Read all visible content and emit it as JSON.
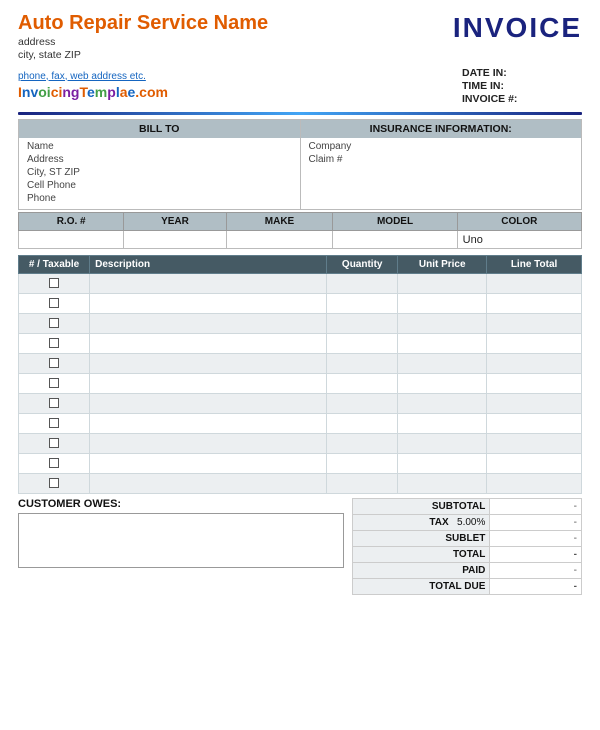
{
  "header": {
    "company_name": "Auto Repair Service Name",
    "invoice_title": "INVOICE",
    "address1": "address",
    "address2": "city, state ZIP",
    "phone": "phone, fax, web address etc.",
    "logo": "InvoicingTemplate.com",
    "date_in_label": "DATE IN:",
    "time_in_label": "TIME IN:",
    "invoice_num_label": "INVOICE #:",
    "date_in_value": "",
    "time_in_value": "",
    "invoice_num_value": ""
  },
  "bill_to": {
    "header": "BILL TO",
    "fields": [
      "Name",
      "Address",
      "City, ST ZIP",
      "Cell Phone",
      "Phone"
    ]
  },
  "insurance": {
    "header": "INSURANCE INFORMATION:",
    "fields": [
      "Company",
      "Claim #"
    ]
  },
  "vehicle": {
    "columns": [
      "R.O. #",
      "YEAR",
      "MAKE",
      "MODEL",
      "COLOR"
    ],
    "row": [
      "",
      "",
      "",
      "",
      "Uno"
    ]
  },
  "items": {
    "columns": [
      "# / Taxable",
      "Description",
      "Quantity",
      "Unit Price",
      "Line Total"
    ],
    "rows": [
      {
        "num": "",
        "taxable": false,
        "desc": "",
        "qty": "",
        "price": "",
        "total": ""
      },
      {
        "num": "",
        "taxable": false,
        "desc": "",
        "qty": "",
        "price": "",
        "total": ""
      },
      {
        "num": "",
        "taxable": false,
        "desc": "",
        "qty": "",
        "price": "",
        "total": ""
      },
      {
        "num": "",
        "taxable": false,
        "desc": "",
        "qty": "",
        "price": "",
        "total": ""
      },
      {
        "num": "",
        "taxable": false,
        "desc": "",
        "qty": "",
        "price": "",
        "total": ""
      },
      {
        "num": "",
        "taxable": false,
        "desc": "",
        "qty": "",
        "price": "",
        "total": ""
      },
      {
        "num": "",
        "taxable": false,
        "desc": "",
        "qty": "",
        "price": "",
        "total": ""
      },
      {
        "num": "",
        "taxable": false,
        "desc": "",
        "qty": "",
        "price": "",
        "total": ""
      },
      {
        "num": "",
        "taxable": false,
        "desc": "",
        "qty": "",
        "price": "",
        "total": ""
      },
      {
        "num": "",
        "taxable": false,
        "desc": "",
        "qty": "",
        "price": "",
        "total": ""
      },
      {
        "num": "",
        "taxable": false,
        "desc": "",
        "qty": "",
        "price": "",
        "total": ""
      }
    ]
  },
  "totals": {
    "subtotal_label": "SUBTOTAL",
    "subtotal_value": "-",
    "tax_label": "TAX",
    "tax_rate": "5.00%",
    "tax_value": "-",
    "sublet_label": "SUBLET",
    "sublet_value": "-",
    "total_label": "TOTAL",
    "total_value": "-",
    "paid_label": "PAID",
    "paid_value": "-",
    "total_due_label": "TOTAL DUE",
    "total_due_value": "-"
  },
  "customer_owes": {
    "label": "CUSTOMER OWES:",
    "value": ""
  }
}
